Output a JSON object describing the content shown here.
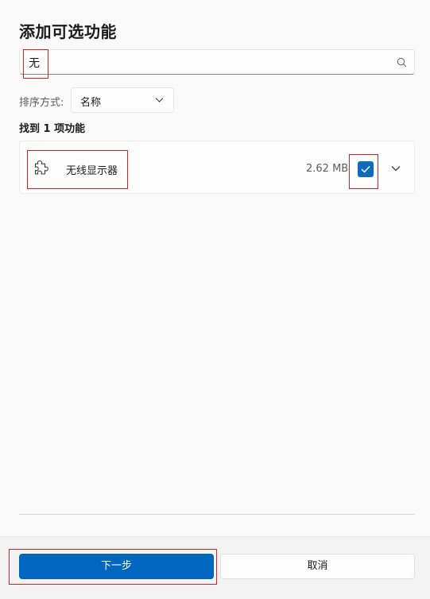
{
  "dialog": {
    "title": "添加可选功能"
  },
  "search": {
    "value": "无",
    "icon": "search-icon"
  },
  "sort": {
    "label": "排序方式:",
    "selected": "名称"
  },
  "results": {
    "count_text": "找到 1 项功能"
  },
  "features": [
    {
      "icon": "puzzle-piece-icon",
      "name": "无线显示器",
      "size": "2.62 MB",
      "checked": true
    }
  ],
  "footer": {
    "next_label": "下一步",
    "cancel_label": "取消"
  },
  "colors": {
    "accent": "#0067c0",
    "highlight": "#e02020"
  }
}
